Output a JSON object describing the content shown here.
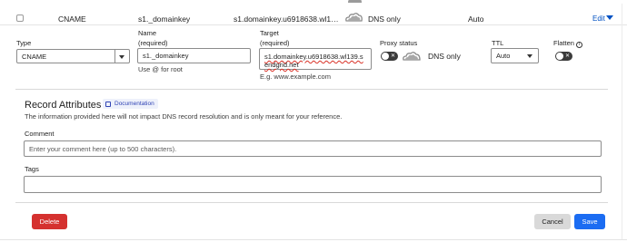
{
  "record_row": {
    "type": "CNAME",
    "name": "s1._domainkey",
    "content": "s1.domainkey.u6918638.wl1…",
    "proxy_status": "DNS only",
    "ttl": "Auto",
    "edit_label": "Edit"
  },
  "form": {
    "type_label": "Type",
    "type_value": "CNAME",
    "name_label_1": "Name",
    "name_label_2": "(required)",
    "name_value": "s1._domainkey",
    "name_hint": "Use @ for root",
    "target_label_1": "Target",
    "target_label_2": "(required)",
    "target_value": "s1.domainkey.u6918638.wl139.sendgrid.net",
    "target_hint": "E.g. www.example.com",
    "proxy_label": "Proxy status",
    "proxy_value": "DNS only",
    "ttl_label": "TTL",
    "ttl_value": "Auto",
    "flatten_label": "Flatten"
  },
  "record_attributes": {
    "title": "Record Attributes",
    "documentation_badge": "Documentation",
    "description": "The information provided here will not impact DNS record resolution and is only meant for your reference.",
    "comment_label": "Comment",
    "comment_placeholder": "Enter your comment here (up to 500 characters).",
    "tags_label": "Tags",
    "tags_value": ""
  },
  "buttons": {
    "delete": "Delete",
    "cancel": "Cancel",
    "save": "Save"
  },
  "colors": {
    "delete_bg": "#d5312f",
    "save_bg": "#1b6cf2",
    "cancel_bg": "#d9d9d9",
    "link": "#0051c3",
    "badge_bg": "#eef1fb",
    "badge_text": "#3044b5"
  },
  "icons": {
    "cloud": "cloud-icon",
    "toggle_off": "toggle-off-icon",
    "info": "info-icon",
    "caret": "caret-down-icon",
    "documentation": "document-icon"
  }
}
